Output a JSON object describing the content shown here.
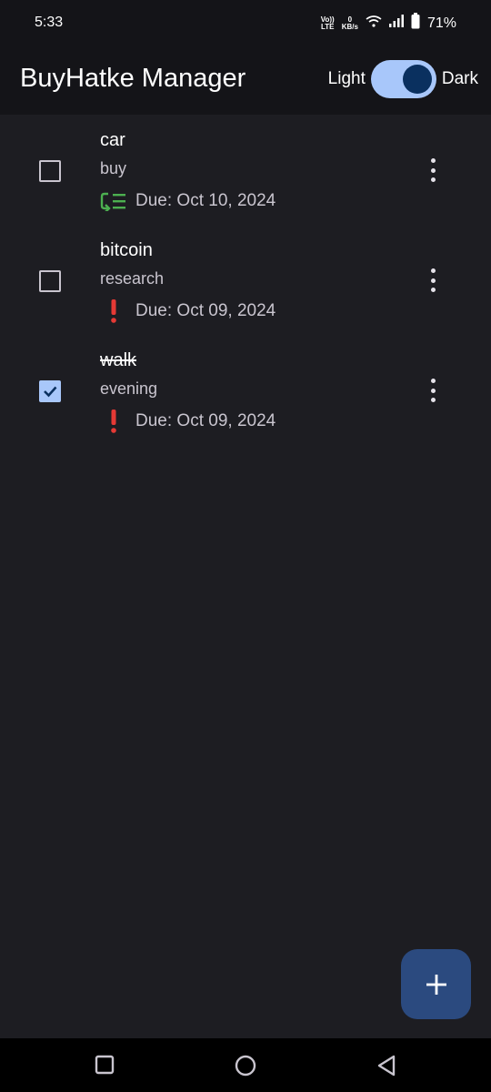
{
  "status_bar": {
    "time": "5:33",
    "network_top": "Vo))",
    "network_bottom": "LTE",
    "speed_value": "0",
    "speed_unit": "KB/s",
    "battery": "71%"
  },
  "app_bar": {
    "title": "BuyHatke Manager",
    "toggle_light_label": "Light",
    "toggle_dark_label": "Dark",
    "dark_mode_on": true
  },
  "tasks": [
    {
      "title": "car",
      "subtitle": "buy",
      "due": "Due: Oct 10, 2024",
      "icon": "repeat-list-icon",
      "icon_color": "#4caf50",
      "checked": false
    },
    {
      "title": "bitcoin",
      "subtitle": "research",
      "due": "Due: Oct 09, 2024",
      "icon": "exclamation-icon",
      "icon_color": "#e53935",
      "checked": false
    },
    {
      "title": "walk",
      "subtitle": "evening",
      "due": "Due: Oct 09, 2024",
      "icon": "exclamation-icon",
      "icon_color": "#e53935",
      "checked": true
    }
  ],
  "fab": {
    "icon": "plus-icon"
  },
  "colors": {
    "accent": "#a8c7fa",
    "background": "#1d1d22",
    "fab": "#2b4a7f"
  }
}
